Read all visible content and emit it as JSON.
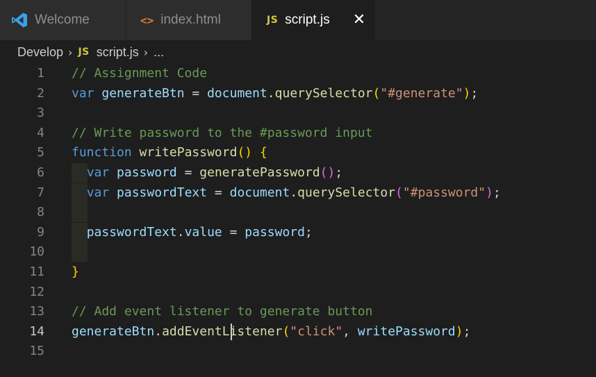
{
  "tabs": [
    {
      "label": "Welcome",
      "icon": "vscode-logo-icon",
      "active": false
    },
    {
      "label": "index.html",
      "icon": "html-file-icon",
      "active": false
    },
    {
      "label": "script.js",
      "icon": "js-file-icon",
      "active": true,
      "close_glyph": "✕"
    }
  ],
  "breadcrumb": {
    "folder": "Develop",
    "file_icon_text": "JS",
    "file": "script.js",
    "more": "..."
  },
  "editor": {
    "current_line": 14,
    "line_numbers": [
      "1",
      "2",
      "3",
      "4",
      "5",
      "6",
      "7",
      "8",
      "9",
      "10",
      "11",
      "12",
      "13",
      "14",
      "15"
    ],
    "lines": [
      [
        {
          "t": "// Assignment Code",
          "c": "comment"
        }
      ],
      [
        {
          "t": "var",
          "c": "keyword"
        },
        {
          "t": " ",
          "c": "punc"
        },
        {
          "t": "generateBtn",
          "c": "var"
        },
        {
          "t": " = ",
          "c": "punc"
        },
        {
          "t": "document",
          "c": "var"
        },
        {
          "t": ".",
          "c": "punc"
        },
        {
          "t": "querySelector",
          "c": "func"
        },
        {
          "t": "(",
          "c": "paren1"
        },
        {
          "t": "\"#generate\"",
          "c": "str"
        },
        {
          "t": ")",
          "c": "paren1"
        },
        {
          "t": ";",
          "c": "punc"
        }
      ],
      [],
      [
        {
          "t": "// Write password to the #password input",
          "c": "comment"
        }
      ],
      [
        {
          "t": "function",
          "c": "keyword"
        },
        {
          "t": " ",
          "c": "punc"
        },
        {
          "t": "writePassword",
          "c": "func"
        },
        {
          "t": "()",
          "c": "paren1"
        },
        {
          "t": " ",
          "c": "punc"
        },
        {
          "t": "{",
          "c": "paren1"
        }
      ],
      [
        {
          "t": "  ",
          "c": "punc"
        },
        {
          "t": "var",
          "c": "keyword"
        },
        {
          "t": " ",
          "c": "punc"
        },
        {
          "t": "password",
          "c": "var"
        },
        {
          "t": " = ",
          "c": "punc"
        },
        {
          "t": "generatePassword",
          "c": "func"
        },
        {
          "t": "()",
          "c": "paren2"
        },
        {
          "t": ";",
          "c": "punc"
        }
      ],
      [
        {
          "t": "  ",
          "c": "punc"
        },
        {
          "t": "var",
          "c": "keyword"
        },
        {
          "t": " ",
          "c": "punc"
        },
        {
          "t": "passwordText",
          "c": "var"
        },
        {
          "t": " = ",
          "c": "punc"
        },
        {
          "t": "document",
          "c": "var"
        },
        {
          "t": ".",
          "c": "punc"
        },
        {
          "t": "querySelector",
          "c": "func"
        },
        {
          "t": "(",
          "c": "paren2"
        },
        {
          "t": "\"#password\"",
          "c": "str"
        },
        {
          "t": ")",
          "c": "paren2"
        },
        {
          "t": ";",
          "c": "punc"
        }
      ],
      [],
      [
        {
          "t": "  ",
          "c": "punc"
        },
        {
          "t": "passwordText",
          "c": "var"
        },
        {
          "t": ".",
          "c": "punc"
        },
        {
          "t": "value",
          "c": "var"
        },
        {
          "t": " = ",
          "c": "punc"
        },
        {
          "t": "password",
          "c": "var"
        },
        {
          "t": ";",
          "c": "punc"
        }
      ],
      [],
      [
        {
          "t": "}",
          "c": "paren1"
        }
      ],
      [],
      [
        {
          "t": "// Add event listener to generate button",
          "c": "comment"
        }
      ],
      [
        {
          "t": "generateBtn",
          "c": "var"
        },
        {
          "t": ".",
          "c": "punc"
        },
        {
          "t": "addEventListener",
          "c": "func"
        },
        {
          "t": "(",
          "c": "paren1"
        },
        {
          "t": "\"click\"",
          "c": "str"
        },
        {
          "t": ", ",
          "c": "punc"
        },
        {
          "t": "writePassword",
          "c": "var"
        },
        {
          "t": ")",
          "c": "paren1"
        },
        {
          "t": ";",
          "c": "punc"
        }
      ],
      []
    ]
  },
  "colors": {
    "background": "#1e1e1e",
    "tabbar": "#252526",
    "comment": "#6a9955",
    "keyword": "#569cd6",
    "variable": "#9cdcfe",
    "function": "#dcdcaa",
    "string": "#ce9178",
    "bracket_level1": "#ffd700",
    "bracket_level2": "#da70d6"
  }
}
